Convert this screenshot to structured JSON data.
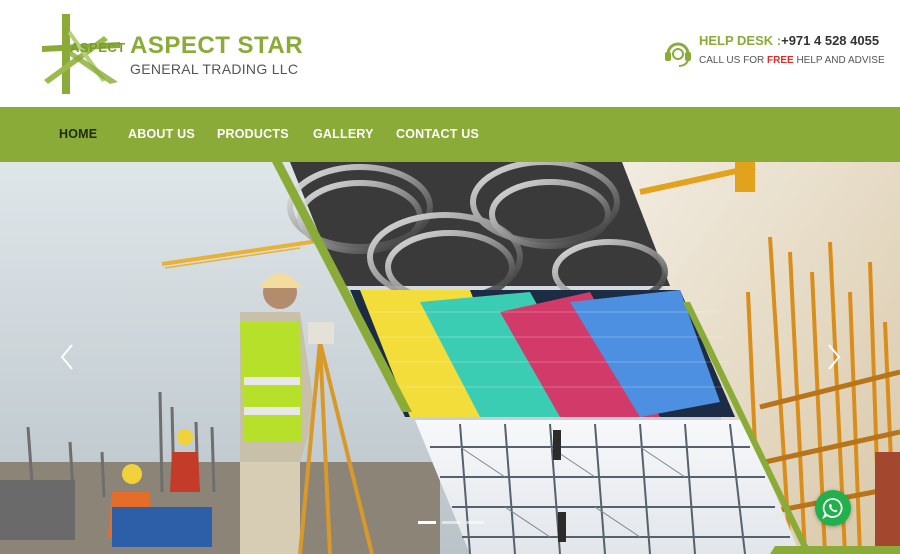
{
  "brand": {
    "logo_word": "ASPECT",
    "name": "ASPECT STAR",
    "subtitle": "GENERAL TRADING LLC"
  },
  "helpdesk": {
    "label": "HELP DESK :",
    "number": "+971 4 528 4055",
    "line2_prefix": "CALL US FOR",
    "line2_free": "FREE",
    "line2_suffix": "HELP AND ADVISE"
  },
  "nav": {
    "items": [
      {
        "label": "HOME",
        "active": true
      },
      {
        "label": "ABOUT US",
        "active": false
      },
      {
        "label": "PRODUCTS",
        "active": false
      },
      {
        "label": "GALLERY",
        "active": false
      },
      {
        "label": "CONTACT US",
        "active": false
      }
    ]
  },
  "slider": {
    "prev_icon": "chevron-left-icon",
    "next_icon": "chevron-right-icon",
    "slide_count": 3,
    "active_slide": 1,
    "panels": [
      "steel-wire-coils",
      "colored-fiberglass-mesh",
      "scaffolding"
    ]
  },
  "whatsapp": {
    "icon": "whatsapp-icon"
  },
  "colors": {
    "brand_green": "#8aab37",
    "nav_active": "#1e2a10",
    "free_red": "#d32f2f",
    "whatsapp_green": "#21b04b"
  }
}
